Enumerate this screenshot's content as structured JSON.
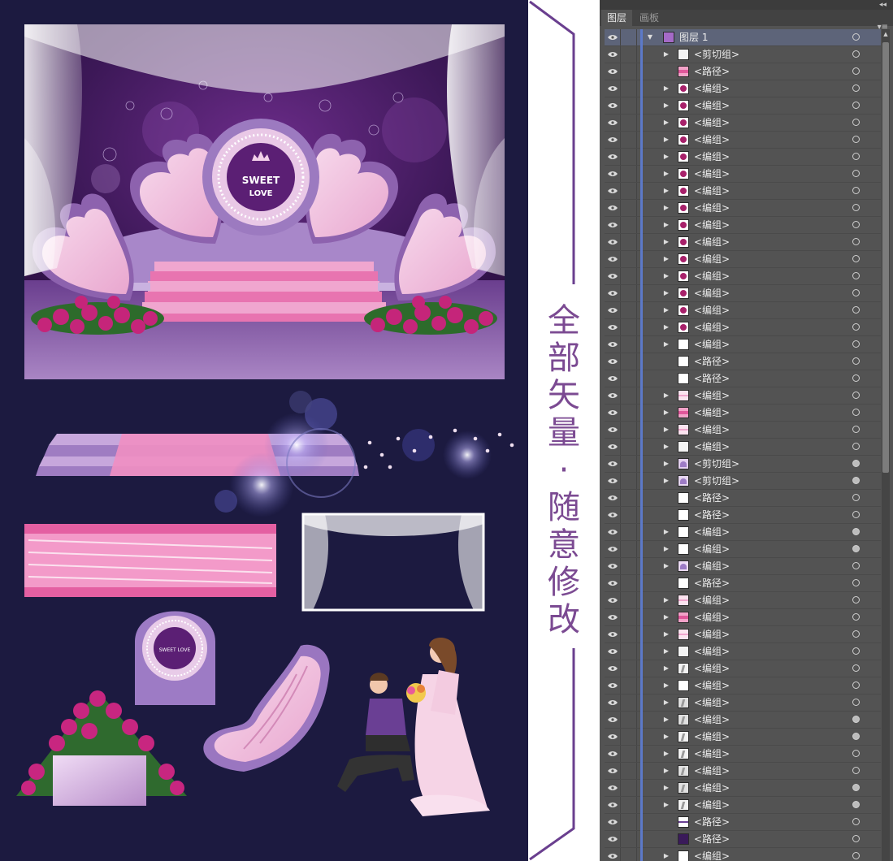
{
  "design": {
    "stage_logo_line1": "SWEET",
    "stage_logo_line2": "LOVE",
    "small_logo_text": "SWEET LOVE",
    "background_color": "#1c1a40",
    "accent_pink": "#e77bb8",
    "accent_purple": "#7b4a92"
  },
  "banner": {
    "chars": [
      "全",
      "部",
      "矢",
      "量",
      "·",
      "随",
      "意",
      "修",
      "改"
    ]
  },
  "panel": {
    "tabs": [
      {
        "label": "图层",
        "active": true
      },
      {
        "label": "画板",
        "active": false
      }
    ],
    "top_layer": {
      "label": "图层 1",
      "expanded": true
    },
    "rows": [
      {
        "label": "<剪切组>",
        "expandable": true,
        "thumb": "sample",
        "target_filled": false
      },
      {
        "label": "<路径>",
        "expandable": false,
        "thumb": "pink-bar",
        "target_filled": false
      },
      {
        "label": "<编组>",
        "expandable": true,
        "thumb": "rose",
        "target_filled": false
      },
      {
        "label": "<编组>",
        "expandable": true,
        "thumb": "rose",
        "target_filled": false
      },
      {
        "label": "<编组>",
        "expandable": true,
        "thumb": "rose",
        "target_filled": false
      },
      {
        "label": "<编组>",
        "expandable": true,
        "thumb": "rose",
        "target_filled": false
      },
      {
        "label": "<编组>",
        "expandable": true,
        "thumb": "rose",
        "target_filled": false
      },
      {
        "label": "<编组>",
        "expandable": true,
        "thumb": "rose",
        "target_filled": false
      },
      {
        "label": "<编组>",
        "expandable": true,
        "thumb": "rose",
        "target_filled": false
      },
      {
        "label": "<编组>",
        "expandable": true,
        "thumb": "rose",
        "target_filled": false
      },
      {
        "label": "<编组>",
        "expandable": true,
        "thumb": "rose",
        "target_filled": false
      },
      {
        "label": "<编组>",
        "expandable": true,
        "thumb": "rose",
        "target_filled": false
      },
      {
        "label": "<编组>",
        "expandable": true,
        "thumb": "rose",
        "target_filled": false
      },
      {
        "label": "<编组>",
        "expandable": true,
        "thumb": "rose",
        "target_filled": false
      },
      {
        "label": "<编组>",
        "expandable": true,
        "thumb": "rose",
        "target_filled": false
      },
      {
        "label": "<编组>",
        "expandable": true,
        "thumb": "rose",
        "target_filled": false
      },
      {
        "label": "<编组>",
        "expandable": true,
        "thumb": "rose",
        "target_filled": false
      },
      {
        "label": "<编组>",
        "expandable": true,
        "thumb": "dots",
        "target_filled": false
      },
      {
        "label": "<路径>",
        "expandable": false,
        "thumb": "plain",
        "target_filled": false
      },
      {
        "label": "<路径>",
        "expandable": false,
        "thumb": "plain",
        "target_filled": false
      },
      {
        "label": "<编组>",
        "expandable": true,
        "thumb": "pink-line",
        "target_filled": false
      },
      {
        "label": "<编组>",
        "expandable": true,
        "thumb": "pink-bar",
        "target_filled": false
      },
      {
        "label": "<编组>",
        "expandable": true,
        "thumb": "pink-line",
        "target_filled": false
      },
      {
        "label": "<编组>",
        "expandable": true,
        "thumb": "lines",
        "target_filled": false
      },
      {
        "label": "<剪切组>",
        "expandable": true,
        "thumb": "purple-shape",
        "target_filled": true
      },
      {
        "label": "<剪切组>",
        "expandable": true,
        "thumb": "purple-wing",
        "target_filled": true
      },
      {
        "label": "<路径>",
        "expandable": false,
        "thumb": "plain",
        "target_filled": false
      },
      {
        "label": "<路径>",
        "expandable": false,
        "thumb": "plain",
        "target_filled": false
      },
      {
        "label": "<编组>",
        "expandable": true,
        "thumb": "plain",
        "target_filled": true
      },
      {
        "label": "<编组>",
        "expandable": true,
        "thumb": "plain",
        "target_filled": true
      },
      {
        "label": "<编组>",
        "expandable": true,
        "thumb": "purple-arc",
        "target_filled": false
      },
      {
        "label": "<路径>",
        "expandable": false,
        "thumb": "plain",
        "target_filled": false
      },
      {
        "label": "<编组>",
        "expandable": true,
        "thumb": "pink-line",
        "target_filled": false
      },
      {
        "label": "<编组>",
        "expandable": true,
        "thumb": "pink-bar",
        "target_filled": false
      },
      {
        "label": "<编组>",
        "expandable": true,
        "thumb": "pink-line",
        "target_filled": false
      },
      {
        "label": "<编组>",
        "expandable": true,
        "thumb": "lines",
        "target_filled": false
      },
      {
        "label": "<编组>",
        "expandable": true,
        "thumb": "stroke",
        "target_filled": false
      },
      {
        "label": "<编组>",
        "expandable": true,
        "thumb": "dashes",
        "target_filled": false
      },
      {
        "label": "<编组>",
        "expandable": true,
        "thumb": "gray-shape",
        "target_filled": false
      },
      {
        "label": "<编组>",
        "expandable": true,
        "thumb": "gray-shape",
        "target_filled": true
      },
      {
        "label": "<编组>",
        "expandable": true,
        "thumb": "stroke",
        "target_filled": true
      },
      {
        "label": "<编组>",
        "expandable": true,
        "thumb": "stroke",
        "target_filled": false
      },
      {
        "label": "<编组>",
        "expandable": true,
        "thumb": "gray-shape",
        "target_filled": false
      },
      {
        "label": "<编组>",
        "expandable": true,
        "thumb": "gray-shape",
        "target_filled": true
      },
      {
        "label": "<编组>",
        "expandable": true,
        "thumb": "stroke",
        "target_filled": true
      },
      {
        "label": "<路径>",
        "expandable": false,
        "thumb": "purple-line",
        "target_filled": false
      },
      {
        "label": "<路径>",
        "expandable": false,
        "thumb": "dark-purple",
        "target_filled": false
      },
      {
        "label": "<编组>",
        "expandable": true,
        "thumb": "plain",
        "target_filled": false
      }
    ]
  }
}
